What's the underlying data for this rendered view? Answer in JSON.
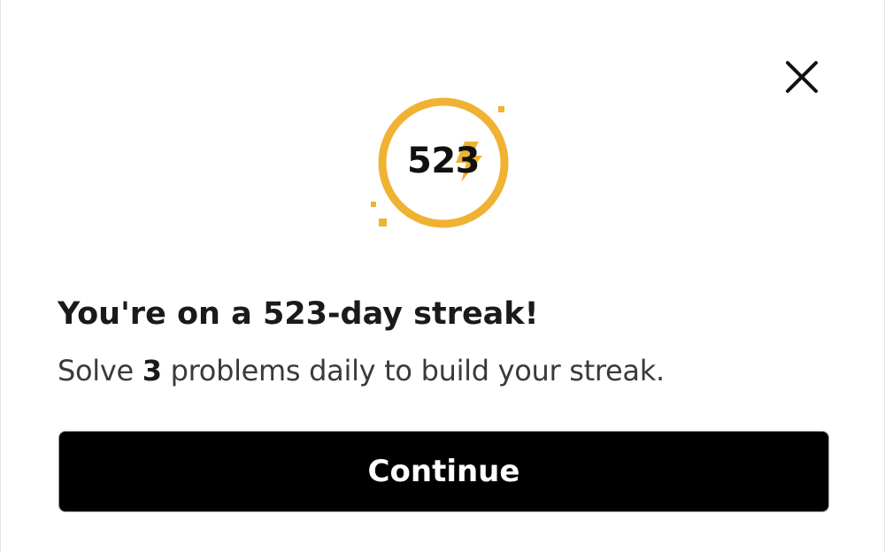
{
  "dialog": {
    "close_icon": "close-icon",
    "streak_badge": {
      "count": "523",
      "accent_color": "#F0B232",
      "icon": "lightning-bolt-icon"
    },
    "title": "You're on a 523-day streak!",
    "subtitle": {
      "prefix": "Solve ",
      "count": "3",
      "suffix": " problems daily to build your streak."
    },
    "continue_label": "Continue"
  }
}
